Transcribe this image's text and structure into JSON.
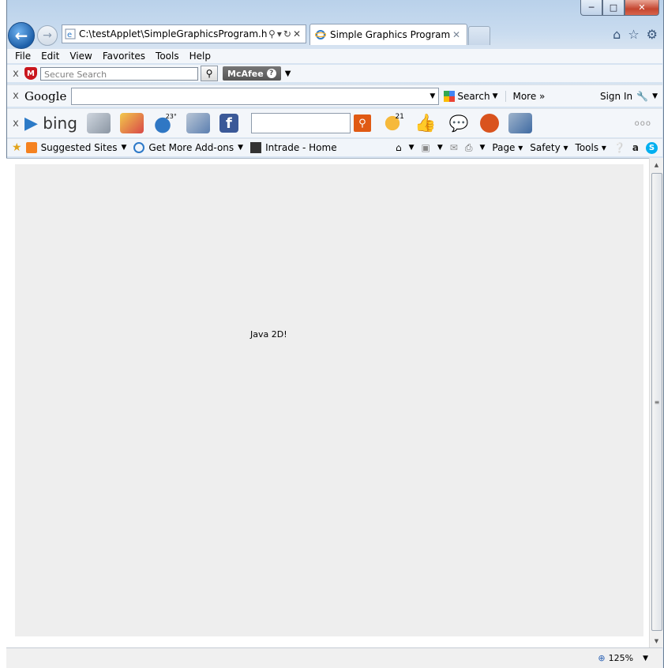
{
  "browser": {
    "address_url": "C:\\testApplet\\SimpleGraphicsProgram.h",
    "tab_title": "Simple Graphics Program"
  },
  "menu": [
    "File",
    "Edit",
    "View",
    "Favorites",
    "Tools",
    "Help"
  ],
  "mcafee": {
    "search_placeholder": "Secure Search",
    "brand": "McAfee"
  },
  "google_toolbar": {
    "logo": "Google",
    "search_label": "Search",
    "more_label": "More »",
    "sign_in": "Sign In"
  },
  "bing_toolbar": {
    "logo": "bing",
    "weather_temp": "23°",
    "badge_count": "21",
    "dots": "ooo"
  },
  "favorites_bar": {
    "items": [
      "Suggested Sites",
      "Get More Add-ons",
      "Intrade - Home"
    ],
    "commands": [
      "Page",
      "Safety",
      "Tools"
    ]
  },
  "applet": {
    "text": "Java 2D!"
  },
  "status": {
    "zoom": "125%"
  }
}
